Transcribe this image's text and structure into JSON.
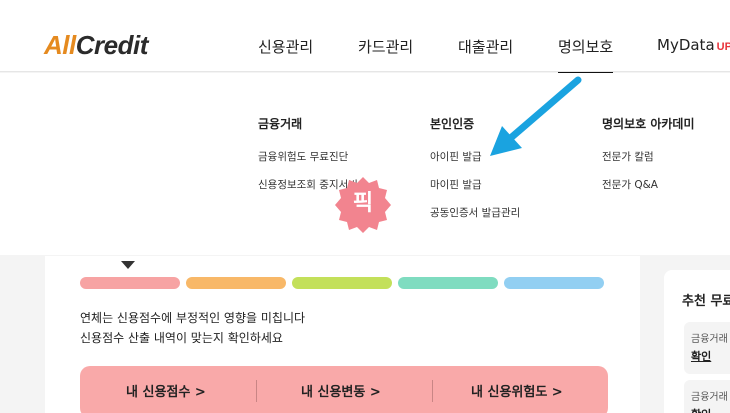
{
  "header": {
    "logo_part1": "All",
    "logo_part2": "Credit",
    "nav": [
      {
        "label": "신용관리"
      },
      {
        "label": "카드관리"
      },
      {
        "label": "대출관리"
      },
      {
        "label": "명의보호",
        "active": true
      },
      {
        "label": "MyData",
        "badge": "UP"
      }
    ],
    "top_right_text": "· ·"
  },
  "dropdown": {
    "columns": [
      {
        "heading": "금융거래",
        "links": [
          "금융위험도 무료진단",
          "신용정보조회 중지서비스"
        ]
      },
      {
        "heading": "본인인증",
        "links": [
          "아이핀 발급",
          "마이핀 발급",
          "공동인증서 발급관리"
        ]
      },
      {
        "heading": "명의보호 아카데미",
        "links": [
          "전문가 칼럼",
          "전문가 Q&A"
        ]
      }
    ]
  },
  "sticker": {
    "text": "픽",
    "color": "#f2848f"
  },
  "annotation": {
    "arrow_color": "#1aa3e0"
  },
  "score_bars": {
    "colors": [
      "#f7a3a3",
      "#f8b868",
      "#c3e05a",
      "#7fdcc0",
      "#92cff2"
    ],
    "marker_index": 0
  },
  "description": {
    "line1": "연체는 신용점수에 부정적인 영향을 미칩니다",
    "line2": "신용점수 산출 내역이 맞는지 확인하세요"
  },
  "actions": {
    "score_label": "내 신용점수 >",
    "change_label": "내 신용변동 >",
    "risk_label": "내 신용위험도 >",
    "bg_color": "#f9a9a9"
  },
  "side_panel": {
    "title": "추천 무료",
    "items": [
      {
        "label": "금융거래",
        "value": "확인"
      },
      {
        "label": "금융거래",
        "value": "확인"
      }
    ]
  }
}
